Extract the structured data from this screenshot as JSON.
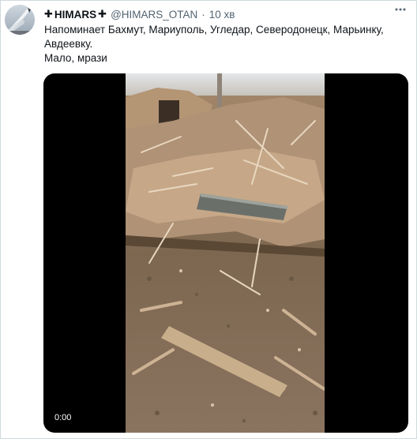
{
  "author": {
    "name": "HIMARS",
    "cross_glyph": "✚",
    "handle": "@HIMARS_OTAN",
    "separator": "·",
    "time": "10 хв"
  },
  "tweet": {
    "line1": "Напоминает Бахмут, Мариуполь, Угледар, Северодонецк, Марьинку,",
    "line2": "Авдеевку.",
    "line3": "Мало, мрази"
  },
  "media": {
    "type": "video",
    "duration": "0:00"
  },
  "icons": {
    "more": "more-horizontal-icon",
    "avatar": "rocket-launch-avatar"
  },
  "colors": {
    "text": "#0f1419",
    "secondary": "#536471",
    "media_bg": "#000000"
  }
}
